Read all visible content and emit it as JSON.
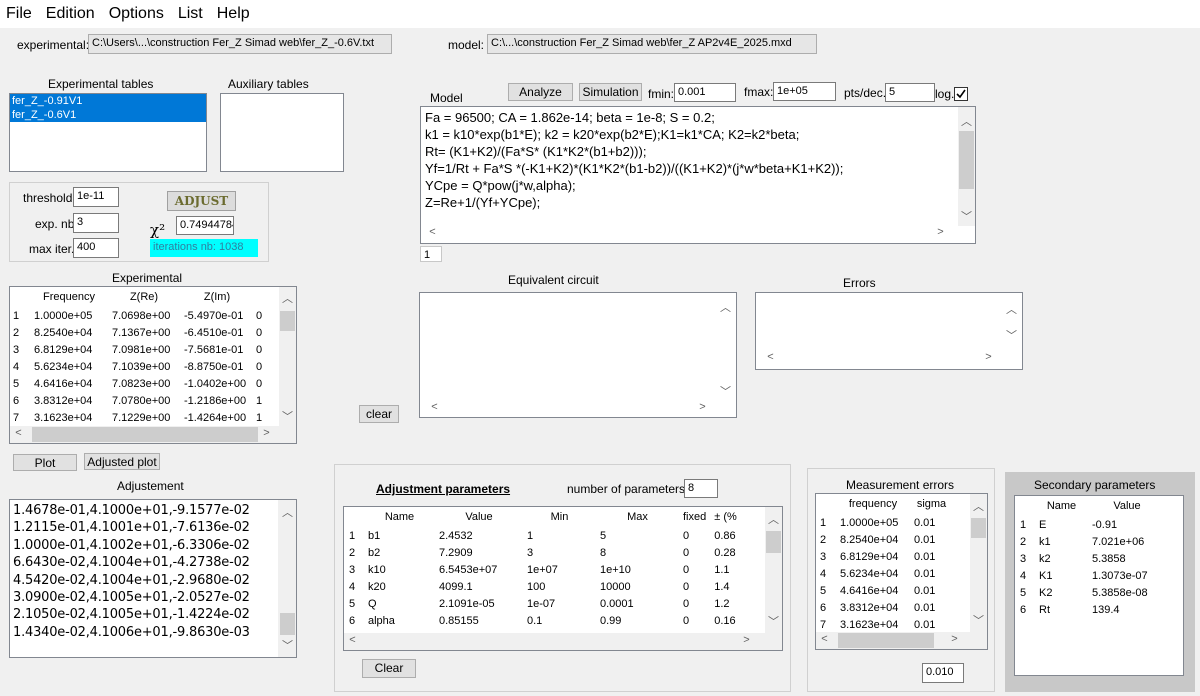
{
  "menu": [
    "File",
    "Edition",
    "Options",
    "List",
    "Help"
  ],
  "experimental_label": "experimental:",
  "experimental_path": "C:\\Users\\...\\construction Fer_Z Simad web\\fer_Z_-0.6V.txt",
  "model_label": "model:",
  "model_path": "C:\\...\\construction Fer_Z Simad web\\fer_Z AP2v4E_2025.mxd",
  "exp_tables": {
    "label": "Experimental tables",
    "items": [
      "fer_Z_-0.91V1",
      "fer_Z_-0.6V1"
    ]
  },
  "aux_tables": {
    "label": "Auxiliary tables"
  },
  "adjust_box": {
    "threshold_label": "threshold",
    "threshold": "1e-11",
    "expnb_label": "exp. nb",
    "expnb": "3",
    "maxiter_label": "max iter.",
    "maxiter": "400",
    "adjust_label": "ADJUST",
    "chi_symbol": "χ²",
    "chi_value": "0.74944784",
    "iterations": "iterations nb: 1038"
  },
  "experimental": {
    "label": "Experimental",
    "columns": [
      "Frequency",
      "Z(Re)",
      "Z(Im)"
    ],
    "rows": [
      [
        "1",
        "1.0000e+05",
        "7.0698e+00",
        "-5.4970e-01",
        "0"
      ],
      [
        "2",
        "8.2540e+04",
        "7.1367e+00",
        "-6.4510e-01",
        "0"
      ],
      [
        "3",
        "6.8129e+04",
        "7.0981e+00",
        "-7.5681e-01",
        "0"
      ],
      [
        "4",
        "5.6234e+04",
        "7.1039e+00",
        "-8.8750e-01",
        "0"
      ],
      [
        "5",
        "4.6416e+04",
        "7.0823e+00",
        "-1.0402e+00",
        "0"
      ],
      [
        "6",
        "3.8312e+04",
        "7.0780e+00",
        "-1.2186e+00",
        "1"
      ],
      [
        "7",
        "3.1623e+04",
        "7.1229e+00",
        "-1.4264e+00",
        "1"
      ]
    ]
  },
  "plot_button": "Plot",
  "adjusted_plot_button": "Adjusted plot",
  "adjustement": {
    "label": "Adjustement",
    "lines": [
      "1.4678e-01,4.1000e+01,-9.1577e-02",
      "1.2115e-01,4.1001e+01,-7.6136e-02",
      "1.0000e-01,4.1002e+01,-6.3306e-02",
      "6.6430e-02,4.1004e+01,-4.2738e-02",
      "4.5420e-02,4.1004e+01,-2.9680e-02",
      "3.0900e-02,4.1005e+01,-2.0527e-02",
      "2.1050e-02,4.1005e+01,-1.4224e-02",
      "1.4340e-02,4.1006e+01,-9.8630e-03"
    ]
  },
  "model": {
    "label": "Model",
    "analyze_button": "Analyze",
    "simulation_button": "Simulation",
    "fmin_label": "fmin:",
    "fmin": "0.001",
    "fmax_label": "fmax:",
    "fmax": "1e+05",
    "ptsdec_label": "pts/dec.",
    "ptsdec": "5",
    "log_label": "log.",
    "log_checked": true,
    "lines": [
      "Fa = 96500; CA = 1.862e-14; beta = 1e-8; S = 0.2;",
      "k1 = k10*exp(b1*E); k2 = k20*exp(b2*E);K1=k1*CA; K2=k2*beta;",
      "Rt= (K1+K2)/(Fa*S* (K1*K2*(b1+b2)));",
      "Yf=1/Rt + Fa*S *(-K1+K2)*(K1*K2*(b1-b2))/((K1+K2)*(j*w*beta+K1+K2));",
      "YCpe = Q*pow(j*w,alpha);",
      "Z=Re+1/(Yf+YCpe);"
    ],
    "line_number": "1"
  },
  "equivalent_circuit": {
    "label": "Equivalent circuit"
  },
  "errors": {
    "label": "Errors"
  },
  "clear_button": "clear",
  "adjustment_parameters": {
    "title": "Adjustment parameters",
    "nparams_label": "number of parameters:",
    "nparams": "8",
    "columns": [
      "Name",
      "Value",
      "Min",
      "Max",
      "fixed",
      "± (%"
    ],
    "rows": [
      [
        "1",
        "b1",
        "2.4532",
        "1",
        "5",
        "0",
        "0.86"
      ],
      [
        "2",
        "b2",
        "7.2909",
        "3",
        "8",
        "0",
        "0.28"
      ],
      [
        "3",
        "k10",
        "6.5453e+07",
        "1e+07",
        "1e+10",
        "0",
        "1.1"
      ],
      [
        "4",
        "k20",
        "4099.1",
        "100",
        "10000",
        "0",
        "1.4"
      ],
      [
        "5",
        "Q",
        "2.1091e-05",
        "1e-07",
        "0.0001",
        "0",
        "1.2"
      ],
      [
        "6",
        "alpha",
        "0.85155",
        "0.1",
        "0.99",
        "0",
        "0.16"
      ]
    ],
    "clear_button": "Clear"
  },
  "measurement_errors": {
    "title": "Measurement errors",
    "columns": [
      "frequency",
      "sigma"
    ],
    "rows": [
      [
        "1",
        "1.0000e+05",
        "0.01"
      ],
      [
        "2",
        "8.2540e+04",
        "0.01"
      ],
      [
        "3",
        "6.8129e+04",
        "0.01"
      ],
      [
        "4",
        "5.6234e+04",
        "0.01"
      ],
      [
        "5",
        "4.6416e+04",
        "0.01"
      ],
      [
        "6",
        "3.8312e+04",
        "0.01"
      ],
      [
        "7",
        "3.1623e+04",
        "0.01"
      ]
    ],
    "value": "0.010"
  },
  "secondary_parameters": {
    "title": "Secondary parameters",
    "columns": [
      "Name",
      "Value"
    ],
    "rows": [
      [
        "1",
        "E",
        "-0.91"
      ],
      [
        "2",
        "k1",
        "7.021e+06"
      ],
      [
        "3",
        "k2",
        "5.3858"
      ],
      [
        "4",
        "K1",
        "1.3073e-07"
      ],
      [
        "5",
        "K2",
        "5.3858e-08"
      ],
      [
        "6",
        "Rt",
        "139.4"
      ]
    ]
  },
  "colors": {
    "selection": "#0078d7",
    "iterations_bg": "#00ffff",
    "secondary_bg": "#c8c8c8"
  }
}
